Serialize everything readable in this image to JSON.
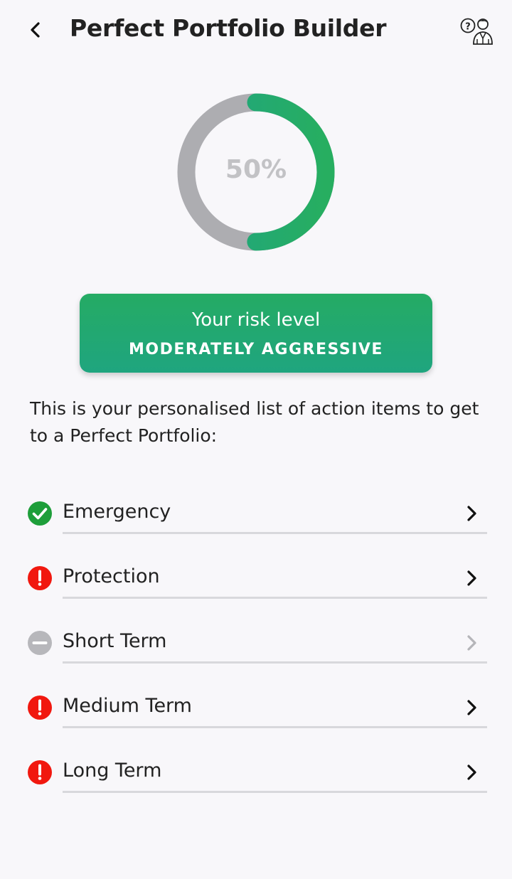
{
  "header": {
    "title": "Perfect Portfolio Builder",
    "back_icon": "chevron-left-icon",
    "help_icon": "help-advisor-icon"
  },
  "gauge": {
    "percent": 50,
    "label": "50%",
    "fill_color": "#23a86b",
    "track_color": "#adadb1"
  },
  "risk": {
    "title": "Your risk level",
    "value": "MODERATELY AGGRESSIVE"
  },
  "intro": "This is your personalised list of action items to get to a Perfect Portfolio:",
  "items": [
    {
      "label": "Emergency",
      "status": "complete",
      "icon": "check-circle-icon",
      "color": "#1e9e3a",
      "enabled": true
    },
    {
      "label": "Protection",
      "status": "warning",
      "icon": "exclamation-circle-icon",
      "color": "#f1180f",
      "enabled": true
    },
    {
      "label": "Short Term",
      "status": "disabled",
      "icon": "minus-circle-icon",
      "color": "#b7b7bb",
      "enabled": false
    },
    {
      "label": "Medium Term",
      "status": "warning",
      "icon": "exclamation-circle-icon",
      "color": "#f1180f",
      "enabled": true
    },
    {
      "label": "Long Term",
      "status": "warning",
      "icon": "exclamation-circle-icon",
      "color": "#f1180f",
      "enabled": true
    }
  ]
}
